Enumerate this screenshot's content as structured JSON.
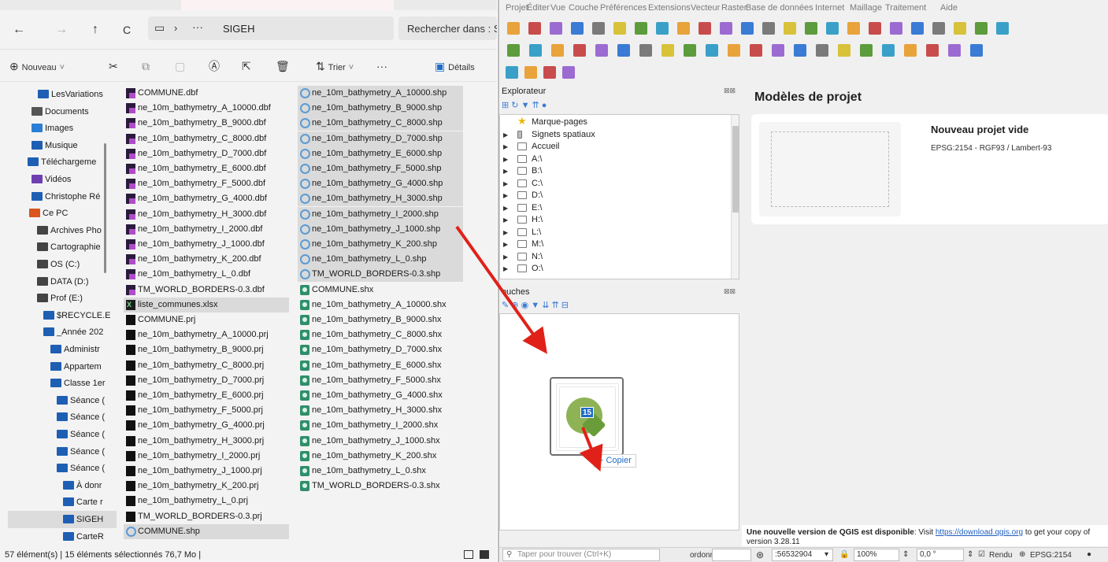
{
  "explorer": {
    "breadcrumb": {
      "ellipsis": "···",
      "folder": "SIGEH"
    },
    "search_placeholder": "Rechercher dans : SI",
    "toolbar": {
      "new_label": "Nouveau",
      "sort_label": "Trier",
      "more_label": "···",
      "details_label": "Détails"
    },
    "nav_items": [
      {
        "label": "LesVariations",
        "icon": "folder-icon",
        "color": "#1e5fb4"
      },
      {
        "label": "Documents",
        "icon": "documents-icon",
        "color": "#555555"
      },
      {
        "label": "Images",
        "icon": "images-icon",
        "color": "#2a7fd4"
      },
      {
        "label": "Musique",
        "icon": "music-icon",
        "color": "#1e5fb4"
      },
      {
        "label": "Téléchargeme",
        "icon": "download-icon",
        "color": "#1e5fb4"
      },
      {
        "label": "Vidéos",
        "icon": "videos-icon",
        "color": "#6f3fb0"
      },
      {
        "label": "Christophe Ré",
        "icon": "folder-icon",
        "color": "#1e5fb4"
      },
      {
        "label": "Ce PC",
        "icon": "pc-icon",
        "color": "#d9541e"
      },
      {
        "label": "Archives Pho",
        "icon": "drive-icon",
        "color": "#444444"
      },
      {
        "label": "Cartographie",
        "icon": "drive-icon",
        "color": "#444444"
      },
      {
        "label": "OS (C:)",
        "icon": "drive-icon",
        "color": "#444444"
      },
      {
        "label": "DATA (D:)",
        "icon": "drive-icon",
        "color": "#444444"
      },
      {
        "label": "Prof (E:)",
        "icon": "drive-icon",
        "color": "#444444"
      },
      {
        "label": "$RECYCLE.E",
        "icon": "folder-icon",
        "color": "#1e5fb4"
      },
      {
        "label": "_Année 202",
        "icon": "folder-icon",
        "color": "#1e5fb4"
      },
      {
        "label": "Administr",
        "icon": "folder-icon",
        "color": "#1e5fb4"
      },
      {
        "label": "Appartem",
        "icon": "folder-icon",
        "color": "#1e5fb4"
      },
      {
        "label": "Classe 1er",
        "icon": "folder-icon",
        "color": "#1e5fb4"
      },
      {
        "label": "Séance (",
        "icon": "folder-icon",
        "color": "#1e5fb4"
      },
      {
        "label": "Séance (",
        "icon": "folder-icon",
        "color": "#1e5fb4"
      },
      {
        "label": "Séance (",
        "icon": "folder-icon",
        "color": "#1e5fb4"
      },
      {
        "label": "Séance (",
        "icon": "folder-icon",
        "color": "#1e5fb4"
      },
      {
        "label": "Séance (",
        "icon": "folder-icon",
        "color": "#1e5fb4"
      },
      {
        "label": "À donr",
        "icon": "folder-icon",
        "color": "#1e5fb4"
      },
      {
        "label": "Carte r",
        "icon": "folder-icon",
        "color": "#1e5fb4"
      },
      {
        "label": "SIGEH",
        "icon": "folder-icon",
        "color": "#1e5fb4",
        "selected": true
      },
      {
        "label": "CarteR",
        "icon": "folder-icon",
        "color": "#1e5fb4"
      }
    ],
    "files_col1": [
      {
        "name": "COMMUNE.dbf",
        "type": "dbf"
      },
      {
        "name": "ne_10m_bathymetry_A_10000.dbf",
        "type": "dbf"
      },
      {
        "name": "ne_10m_bathymetry_B_9000.dbf",
        "type": "dbf"
      },
      {
        "name": "ne_10m_bathymetry_C_8000.dbf",
        "type": "dbf"
      },
      {
        "name": "ne_10m_bathymetry_D_7000.dbf",
        "type": "dbf"
      },
      {
        "name": "ne_10m_bathymetry_E_6000.dbf",
        "type": "dbf"
      },
      {
        "name": "ne_10m_bathymetry_F_5000.dbf",
        "type": "dbf"
      },
      {
        "name": "ne_10m_bathymetry_G_4000.dbf",
        "type": "dbf"
      },
      {
        "name": "ne_10m_bathymetry_H_3000.dbf",
        "type": "dbf"
      },
      {
        "name": "ne_10m_bathymetry_I_2000.dbf",
        "type": "dbf"
      },
      {
        "name": "ne_10m_bathymetry_J_1000.dbf",
        "type": "dbf"
      },
      {
        "name": "ne_10m_bathymetry_K_200.dbf",
        "type": "dbf"
      },
      {
        "name": "ne_10m_bathymetry_L_0.dbf",
        "type": "dbf"
      },
      {
        "name": "TM_WORLD_BORDERS-0.3.dbf",
        "type": "dbf"
      },
      {
        "name": "liste_communes.xlsx",
        "type": "xlsx",
        "selected": true
      },
      {
        "name": "COMMUNE.prj",
        "type": "prj"
      },
      {
        "name": "ne_10m_bathymetry_A_10000.prj",
        "type": "prj"
      },
      {
        "name": "ne_10m_bathymetry_B_9000.prj",
        "type": "prj"
      },
      {
        "name": "ne_10m_bathymetry_C_8000.prj",
        "type": "prj"
      },
      {
        "name": "ne_10m_bathymetry_D_7000.prj",
        "type": "prj"
      },
      {
        "name": "ne_10m_bathymetry_E_6000.prj",
        "type": "prj"
      },
      {
        "name": "ne_10m_bathymetry_F_5000.prj",
        "type": "prj"
      },
      {
        "name": "ne_10m_bathymetry_G_4000.prj",
        "type": "prj"
      },
      {
        "name": "ne_10m_bathymetry_H_3000.prj",
        "type": "prj"
      },
      {
        "name": "ne_10m_bathymetry_I_2000.prj",
        "type": "prj"
      },
      {
        "name": "ne_10m_bathymetry_J_1000.prj",
        "type": "prj"
      },
      {
        "name": "ne_10m_bathymetry_K_200.prj",
        "type": "prj"
      },
      {
        "name": "ne_10m_bathymetry_L_0.prj",
        "type": "prj"
      },
      {
        "name": "TM_WORLD_BORDERS-0.3.prj",
        "type": "prj"
      },
      {
        "name": "COMMUNE.shp",
        "type": "shp",
        "selected": true
      }
    ],
    "files_col2": [
      {
        "name": "ne_10m_bathymetry_A_10000.shp",
        "type": "shp",
        "selected": true
      },
      {
        "name": "ne_10m_bathymetry_B_9000.shp",
        "type": "shp",
        "selected": true
      },
      {
        "name": "ne_10m_bathymetry_C_8000.shp",
        "type": "shp",
        "selected": true
      },
      {
        "name": "ne_10m_bathymetry_D_7000.shp",
        "type": "shp",
        "selected": true
      },
      {
        "name": "ne_10m_bathymetry_E_6000.shp",
        "type": "shp",
        "selected": true
      },
      {
        "name": "ne_10m_bathymetry_F_5000.shp",
        "type": "shp",
        "selected": true
      },
      {
        "name": "ne_10m_bathymetry_G_4000.shp",
        "type": "shp",
        "selected": true
      },
      {
        "name": "ne_10m_bathymetry_H_3000.shp",
        "type": "shp",
        "selected": true
      },
      {
        "name": "ne_10m_bathymetry_I_2000.shp",
        "type": "shp",
        "selected": true
      },
      {
        "name": "ne_10m_bathymetry_J_1000.shp",
        "type": "shp",
        "selected": true
      },
      {
        "name": "ne_10m_bathymetry_K_200.shp",
        "type": "shp",
        "selected": true
      },
      {
        "name": "ne_10m_bathymetry_L_0.shp",
        "type": "shp",
        "selected": true
      },
      {
        "name": "TM_WORLD_BORDERS-0.3.shp",
        "type": "shp",
        "selected": true
      },
      {
        "name": "COMMUNE.shx",
        "type": "shx"
      },
      {
        "name": "ne_10m_bathymetry_A_10000.shx",
        "type": "shx"
      },
      {
        "name": "ne_10m_bathymetry_B_9000.shx",
        "type": "shx"
      },
      {
        "name": "ne_10m_bathymetry_C_8000.shx",
        "type": "shx"
      },
      {
        "name": "ne_10m_bathymetry_D_7000.shx",
        "type": "shx"
      },
      {
        "name": "ne_10m_bathymetry_E_6000.shx",
        "type": "shx"
      },
      {
        "name": "ne_10m_bathymetry_F_5000.shx",
        "type": "shx"
      },
      {
        "name": "ne_10m_bathymetry_G_4000.shx",
        "type": "shx"
      },
      {
        "name": "ne_10m_bathymetry_H_3000.shx",
        "type": "shx"
      },
      {
        "name": "ne_10m_bathymetry_I_2000.shx",
        "type": "shx"
      },
      {
        "name": "ne_10m_bathymetry_J_1000.shx",
        "type": "shx"
      },
      {
        "name": "ne_10m_bathymetry_K_200.shx",
        "type": "shx"
      },
      {
        "name": "ne_10m_bathymetry_L_0.shx",
        "type": "shx"
      },
      {
        "name": "TM_WORLD_BORDERS-0.3.shx",
        "type": "shx"
      }
    ],
    "status": "57 élément(s)  |  15 éléments sélectionnés 76,7 Mo  |"
  },
  "qgis": {
    "menu": [
      "Projet",
      "Éditer",
      "Vue",
      "Couche",
      "Préférences",
      "Extensions",
      "Vecteur",
      "Raster",
      "Base de données",
      "Internet",
      "Maillage",
      "Traitement",
      "Aide"
    ],
    "browser_title": "Explorateur",
    "browser_items": [
      {
        "label": "Marque-pages",
        "icon": "star-icon"
      },
      {
        "label": "Signets spatiaux",
        "icon": "bookmark-icon"
      },
      {
        "label": "Accueil",
        "icon": "home-icon"
      },
      {
        "label": "A:\\",
        "icon": "folder-icon"
      },
      {
        "label": "B:\\",
        "icon": "folder-icon"
      },
      {
        "label": "C:\\",
        "icon": "folder-icon"
      },
      {
        "label": "D:\\",
        "icon": "folder-icon"
      },
      {
        "label": "E:\\",
        "icon": "folder-icon"
      },
      {
        "label": "H:\\",
        "icon": "folder-icon"
      },
      {
        "label": "L:\\",
        "icon": "folder-icon"
      },
      {
        "label": "M:\\",
        "icon": "folder-icon"
      },
      {
        "label": "N:\\",
        "icon": "folder-icon"
      },
      {
        "label": "O:\\",
        "icon": "folder-icon"
      }
    ],
    "layers_title": "ouches",
    "drag": {
      "badge": "15",
      "tooltip": "+ Copier"
    },
    "templates_title": "Modèles de projet",
    "template": {
      "name": "Nouveau projet vide",
      "crs": "EPSG:2154 - RGF93 / Lambert-93"
    },
    "update": {
      "bold": "Une nouvelle version de QGIS est disponible",
      "text": ": Visit ",
      "link": "https://download.qgis.org",
      "after": " to get your copy of",
      "line2": "version 3.28.11"
    },
    "status": {
      "locator_placeholder": "Taper pour trouver (Ctrl+K)",
      "coord_label": "ordonr",
      "scale": ":56532904",
      "magnifier": "100%",
      "rotation": "0,0 °",
      "render_label": "Rendu",
      "crs": "EPSG:2154"
    },
    "accent": "#1f6cc4"
  },
  "annotation_color": "#e0211a"
}
